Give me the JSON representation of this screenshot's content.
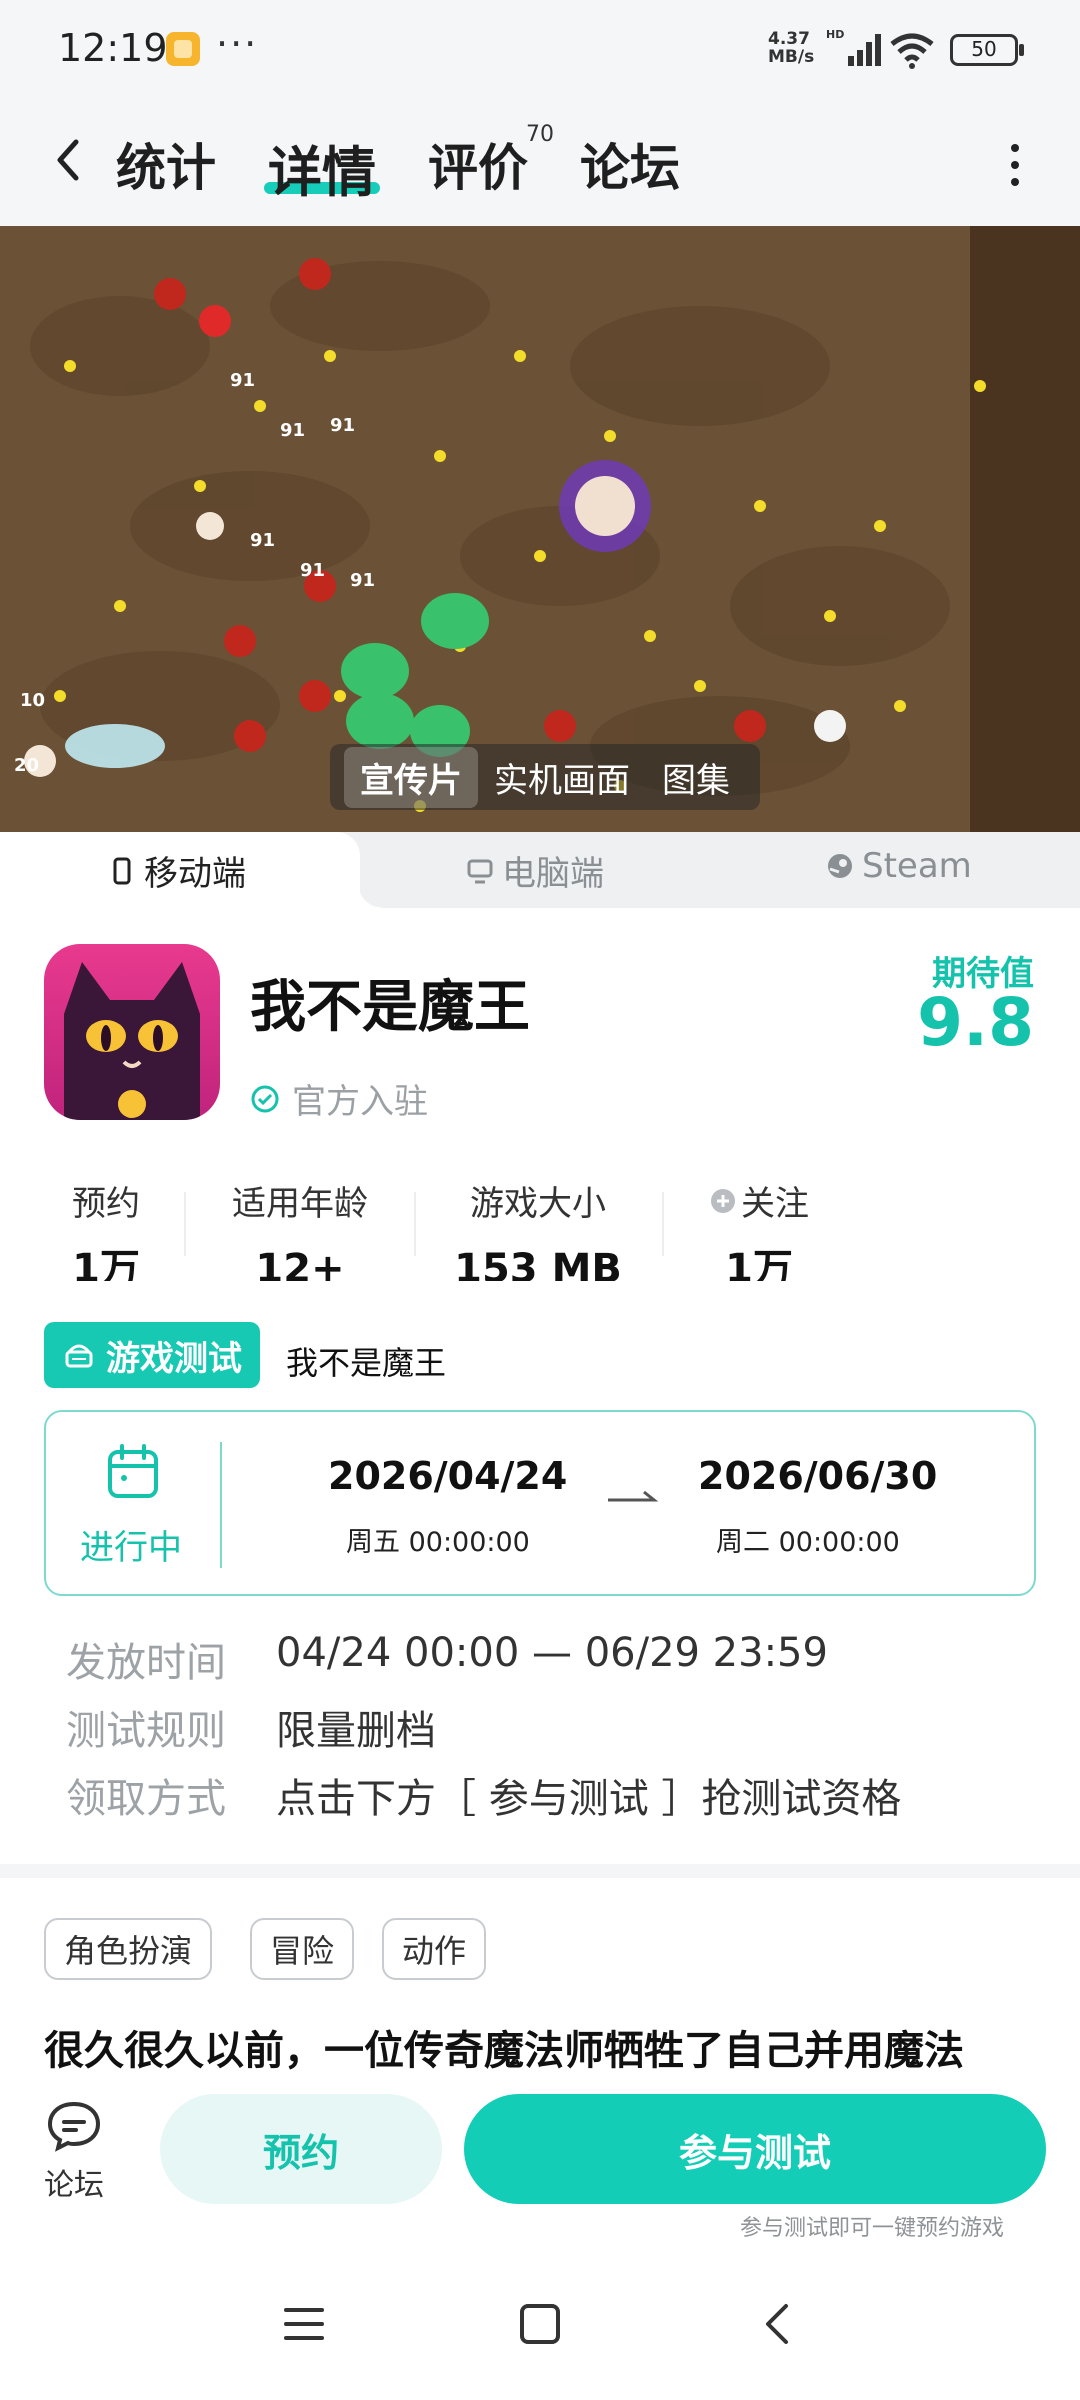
{
  "status_bar": {
    "time": "12:19",
    "more": "···",
    "net_speed": "4.37 MB/s",
    "battery": "50"
  },
  "nav": {
    "tabs": [
      "统计",
      "详情",
      "评价",
      "论坛"
    ],
    "active_tab": "详情",
    "review_count": "70"
  },
  "media": {
    "tabs": [
      "宣传片",
      "实机画面",
      "图集"
    ],
    "active_tab": "宣传片"
  },
  "platforms": {
    "items": [
      "移动端",
      "电脑端",
      "Steam"
    ],
    "active": "移动端"
  },
  "app": {
    "name": "我不是魔王",
    "official_label": "官方入驻",
    "expect_label": "期待值",
    "expect_value": "9.8"
  },
  "stats": [
    {
      "label": "预约",
      "value": "1万"
    },
    {
      "label": "适用年龄",
      "value": "12+"
    },
    {
      "label": "游戏大小",
      "value": "153 MB"
    },
    {
      "label": "关注",
      "value": "1万"
    }
  ],
  "test": {
    "badge": "游戏测试",
    "game": "我不是魔王",
    "status": "进行中",
    "start_date": "2026/04/24",
    "start_week": "周五  00:00:00",
    "end_date": "2026/06/30",
    "end_week": "周二  00:00:00",
    "info": [
      {
        "key": "发放时间",
        "value": "04/24 00:00 — 06/29 23:59"
      },
      {
        "key": "测试规则",
        "value": "限量删档"
      },
      {
        "key": "领取方式",
        "value": "点击下方［ 参与测试 ］抢测试资格"
      }
    ]
  },
  "tags": [
    "角色扮演",
    "冒险",
    "动作"
  ],
  "description": "很久很久以前，一位传奇魔法师牺牲了自己并用魔法",
  "actions": {
    "forum_label": "论坛",
    "reserve_label": "预约",
    "join_label": "参与测试",
    "join_hint": "参与测试即可一键预约游戏"
  },
  "colors": {
    "accent": "#15c3ad",
    "accent_button": "#13cdb7",
    "reserve_bg": "#e6f7f6"
  }
}
